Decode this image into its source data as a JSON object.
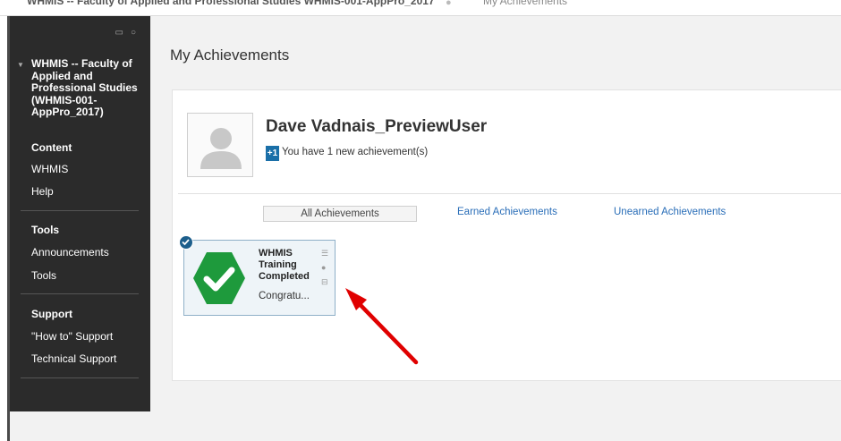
{
  "breadcrumb": {
    "course": "WHMIS -- Faculty of Applied and Professional Studies WHMIS-001-AppPro_2017",
    "current": "My Achievements"
  },
  "sidebar": {
    "course_title": "WHMIS -- Faculty of Applied and Professional Studies (WHMIS-001-AppPro_2017)",
    "items": [
      {
        "label": "Content"
      },
      {
        "label": "WHMIS"
      },
      {
        "label": "Help"
      }
    ],
    "tools_heading": "Tools",
    "tools_items": [
      {
        "label": "Announcements"
      },
      {
        "label": "Tools"
      }
    ],
    "support_heading": "Support",
    "support_items": [
      {
        "label": "\"How to\" Support"
      },
      {
        "label": "Technical Support"
      }
    ]
  },
  "main": {
    "page_title": "My Achievements",
    "user_name": "Dave Vadnais_PreviewUser",
    "new_badge": "+1",
    "new_text": "You have 1 new achievement(s)",
    "tabs": [
      {
        "label": "All Achievements"
      },
      {
        "label": "Earned Achievements"
      },
      {
        "label": "Unearned Achievements"
      }
    ],
    "achievement": {
      "title": "WHMIS Training Completed",
      "description": "Congratu..."
    }
  },
  "colors": {
    "sidebar_bg": "#2b2b2b",
    "link": "#2a6eb8",
    "badge": "#1a6fa8",
    "achievement_green": "#1e9a3c",
    "arrow": "#e00000"
  }
}
